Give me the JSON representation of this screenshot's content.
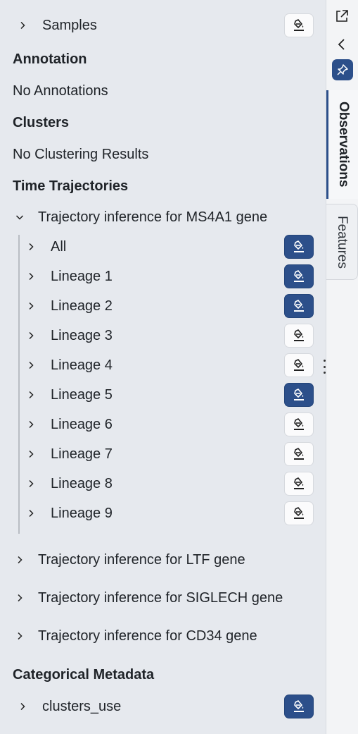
{
  "colors": {
    "accent": "#2c4f8a",
    "panel_bg": "#e6e9ee",
    "text": "#1f2328"
  },
  "samples": {
    "label": "Samples",
    "paint_active": false
  },
  "annotation": {
    "heading": "Annotation",
    "empty": "No Annotations"
  },
  "clusters": {
    "heading": "Clusters",
    "empty": "No Clustering Results"
  },
  "time_trajectories": {
    "heading": "Time Trajectories",
    "groups": [
      {
        "label": "Trajectory inference for MS4A1 gene",
        "expanded": true,
        "children": [
          {
            "label": "All",
            "paint_active": true
          },
          {
            "label": "Lineage 1",
            "paint_active": true
          },
          {
            "label": "Lineage 2",
            "paint_active": true
          },
          {
            "label": "Lineage 3",
            "paint_active": false
          },
          {
            "label": "Lineage 4",
            "paint_active": false
          },
          {
            "label": "Lineage 5",
            "paint_active": true
          },
          {
            "label": "Lineage 6",
            "paint_active": false
          },
          {
            "label": "Lineage 7",
            "paint_active": false
          },
          {
            "label": "Lineage 8",
            "paint_active": false
          },
          {
            "label": "Lineage 9",
            "paint_active": false
          }
        ]
      },
      {
        "label": "Trajectory inference for LTF gene",
        "expanded": false
      },
      {
        "label": "Trajectory inference for SIGLECH gene",
        "expanded": false
      },
      {
        "label": "Trajectory inference for CD34 gene",
        "expanded": false
      }
    ]
  },
  "categorical": {
    "heading": "Categorical Metadata",
    "items": [
      {
        "label": "clusters_use",
        "paint_active": true
      }
    ]
  },
  "sidebar": {
    "icons": [
      "external-link-icon",
      "chevron-left-icon",
      "pin-icon"
    ],
    "tabs": [
      {
        "label": "Observations",
        "active": true
      },
      {
        "label": "Features",
        "active": false
      }
    ]
  }
}
